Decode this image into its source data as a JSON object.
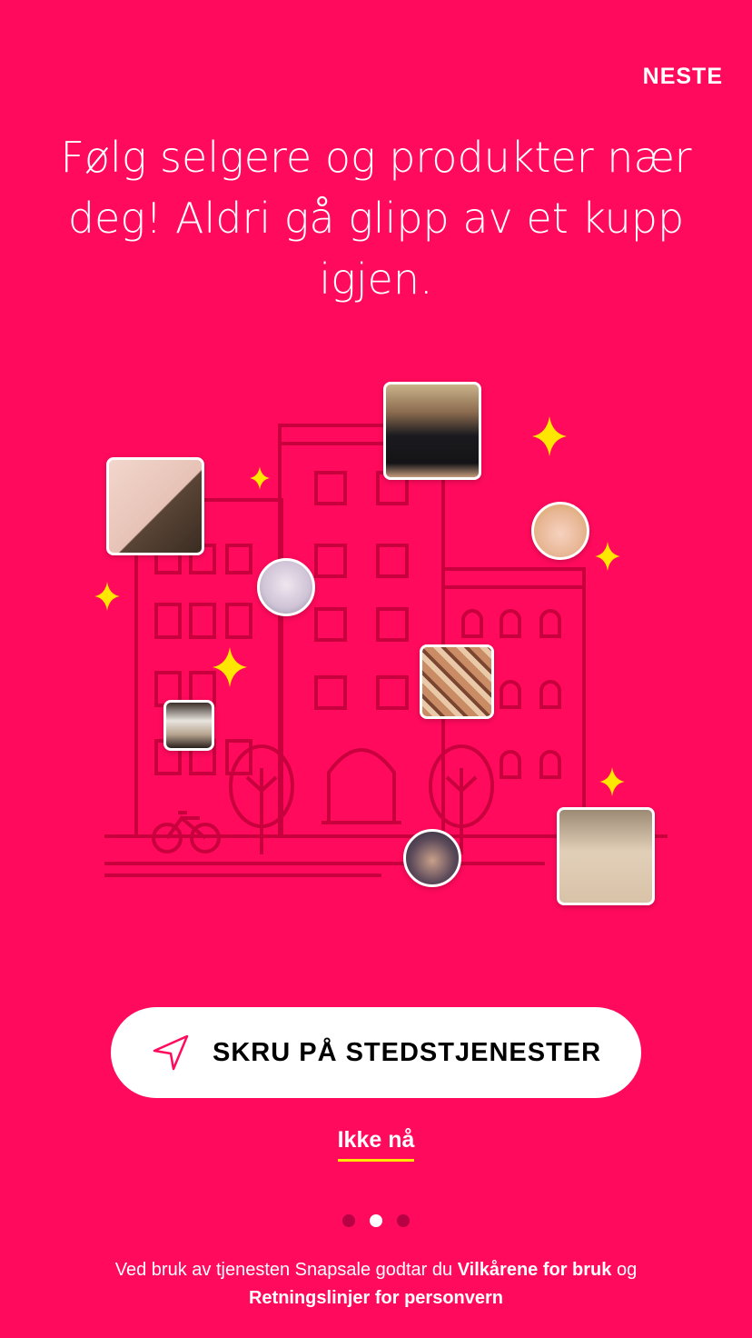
{
  "header": {
    "next_label": "NESTE"
  },
  "headline": "Følg selgere og produkter nær deg! Aldri gå glipp av et kupp igjen.",
  "cta": {
    "label": "SKRU PÅ STEDSTJENESTER",
    "icon": "location-arrow-icon"
  },
  "skip_label": "Ikke nå",
  "pagination": {
    "total": 3,
    "active": 2
  },
  "legal": {
    "prefix": "Ved bruk av tjenesten Snapsale godtar du ",
    "terms_link": "Vilkårene for bruk",
    "middle": " og ",
    "privacy_link": "Retningslinjer for personvern"
  },
  "colors": {
    "background": "#FF0A5C",
    "accent": "#FFE600",
    "building_line": "#C8003E"
  }
}
